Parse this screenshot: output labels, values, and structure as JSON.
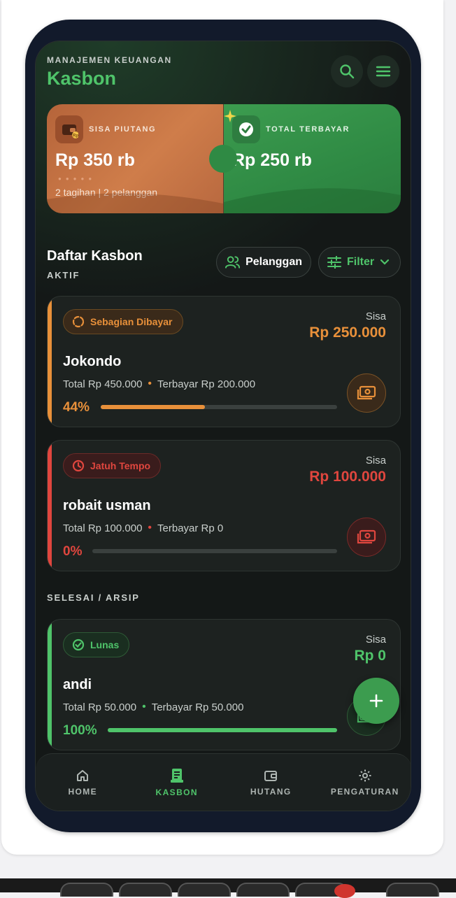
{
  "header": {
    "subtitle": "MANAJEMEN KEUANGAN",
    "title": "Kasbon",
    "icons": [
      "search-icon",
      "menu-icon"
    ]
  },
  "summary": {
    "piutang": {
      "label": "SISA PIUTANG",
      "value": "Rp 350 rb",
      "sub": "2 tagihan | 2 pelanggan",
      "icon": "wallet-icon",
      "icon_badge": "Rp"
    },
    "terbayar": {
      "label": "TOTAL TERBAYAR",
      "value": "Rp 250 rb",
      "icon": "check-icon"
    }
  },
  "list": {
    "title": "Daftar Kasbon",
    "active_label": "AKTIF",
    "customers_button": "Pelanggan",
    "filter_button": "Filter",
    "archive_label": "SELESAI / ARSIP"
  },
  "colors": {
    "accent": "#4fc46a",
    "orange": "#e8903a",
    "red": "#e0463e",
    "green": "#4fc46a"
  },
  "cards": [
    {
      "status": "Sebagian Dibayar",
      "status_icon": "loading-icon",
      "sisa_label": "Sisa",
      "sisa": "Rp 250.000",
      "name": "Jokondo",
      "total": "Total Rp 450.000",
      "paid": "Terbayar Rp 200.000",
      "percent_label": "44%",
      "progress": 0.44,
      "color": "#e8903a"
    },
    {
      "status": "Jatuh Tempo",
      "status_icon": "clock-icon",
      "sisa_label": "Sisa",
      "sisa": "Rp 100.000",
      "name": "robait usman",
      "total": "Total Rp 100.000",
      "paid": "Terbayar Rp 0",
      "percent_label": "0%",
      "progress": 0,
      "color": "#e0463e"
    },
    {
      "status": "Lunas",
      "status_icon": "check-circle-icon",
      "sisa_label": "Sisa",
      "sisa": "Rp 0",
      "name": "andi",
      "total": "Total Rp 50.000",
      "paid": "Terbayar Rp 50.000",
      "percent_label": "100%",
      "progress": 1,
      "color": "#4fc46a"
    }
  ],
  "nav": [
    {
      "label": "HOME",
      "icon": "home-icon"
    },
    {
      "label": "KASBON",
      "icon": "receipt-icon"
    },
    {
      "label": "HUTANG",
      "icon": "wallet-icon"
    },
    {
      "label": "PENGATURAN",
      "icon": "gear-icon"
    }
  ]
}
